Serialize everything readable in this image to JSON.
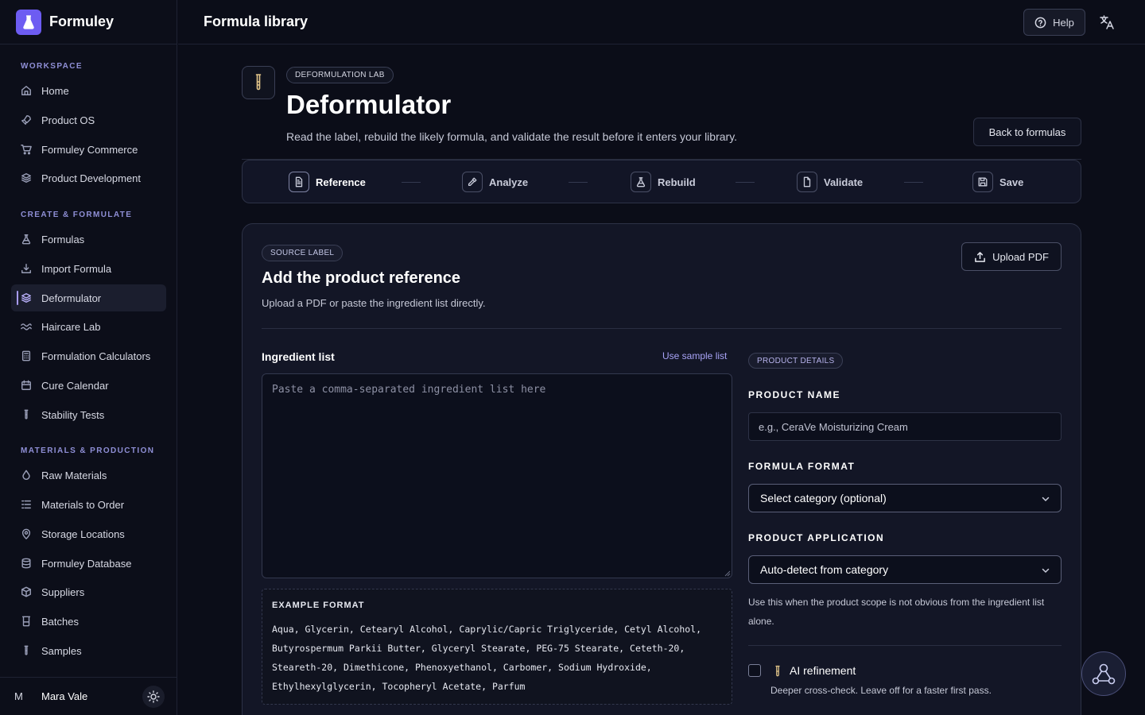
{
  "app": {
    "name": "Formuley",
    "page_heading": "Formula library",
    "help_label": "Help"
  },
  "sidebar": {
    "sections": [
      {
        "title": "WORKSPACE",
        "items": [
          {
            "label": "Home",
            "icon": "home-icon"
          },
          {
            "label": "Product OS",
            "icon": "rocket-icon"
          },
          {
            "label": "Formuley Commerce",
            "icon": "cart-icon"
          },
          {
            "label": "Product Development",
            "icon": "layers-icon"
          }
        ]
      },
      {
        "title": "CREATE & FORMULATE",
        "items": [
          {
            "label": "Formulas",
            "icon": "flask-icon"
          },
          {
            "label": "Import Formula",
            "icon": "download-icon"
          },
          {
            "label": "Deformulator",
            "icon": "layers-icon",
            "active": true
          },
          {
            "label": "Haircare Lab",
            "icon": "waves-icon"
          },
          {
            "label": "Formulation Calculators",
            "icon": "calculator-icon"
          },
          {
            "label": "Cure Calendar",
            "icon": "calendar-icon"
          },
          {
            "label": "Stability Tests",
            "icon": "test-tube-icon"
          }
        ]
      },
      {
        "title": "MATERIALS & PRODUCTION",
        "items": [
          {
            "label": "Raw Materials",
            "icon": "droplet-icon"
          },
          {
            "label": "Materials to Order",
            "icon": "list-icon"
          },
          {
            "label": "Storage Locations",
            "icon": "map-pin-icon"
          },
          {
            "label": "Formuley Database",
            "icon": "database-icon"
          },
          {
            "label": "Suppliers",
            "icon": "package-icon"
          },
          {
            "label": "Batches",
            "icon": "beaker-icon"
          },
          {
            "label": "Samples",
            "icon": "test-tube-icon"
          }
        ]
      }
    ],
    "user": {
      "initial": "M",
      "name": "Mara Vale"
    }
  },
  "header": {
    "badge": "DEFORMULATION LAB",
    "title": "Deformulator",
    "subtitle": "Read the label, rebuild the likely formula, and validate the result before it enters your library.",
    "back_label": "Back to formulas"
  },
  "steps": [
    {
      "label": "Reference",
      "icon": "document-icon",
      "active": true
    },
    {
      "label": "Analyze",
      "icon": "pipette-icon"
    },
    {
      "label": "Rebuild",
      "icon": "flask-icon"
    },
    {
      "label": "Validate",
      "icon": "file-check-icon"
    },
    {
      "label": "Save",
      "icon": "save-icon"
    }
  ],
  "card": {
    "badge": "SOURCE LABEL",
    "title": "Add the product reference",
    "subtitle": "Upload a PDF or paste the ingredient list directly.",
    "upload_label": "Upload PDF",
    "ingredients": {
      "label": "Ingredient list",
      "sample_link": "Use sample list",
      "placeholder": "Paste a comma-separated ingredient list here",
      "value": ""
    },
    "example": {
      "title": "EXAMPLE FORMAT",
      "lines": [
        "Aqua, Glycerin, Cetearyl Alcohol, Caprylic/Capric Triglyceride, Cetyl Alcohol,",
        "Butyrospermum Parkii Butter, Glyceryl Stearate, PEG-75 Stearate, Ceteth-20,",
        "Steareth-20, Dimethicone, Phenoxyethanol, Carbomer, Sodium Hydroxide,",
        "Ethylhexylglycerin, Tocopheryl Acetate, Parfum"
      ]
    },
    "details": {
      "badge": "PRODUCT DETAILS",
      "product_name_label": "PRODUCT NAME",
      "product_name_placeholder": "e.g., CeraVe Moisturizing Cream",
      "product_name_value": "",
      "format_label": "FORMULA FORMAT",
      "format_value": "Select category (optional)",
      "application_label": "PRODUCT APPLICATION",
      "application_value": "Auto-detect from category",
      "hint": "Use this when the product scope is not obvious from the ingredient list alone.",
      "ai_label": "AI refinement",
      "ai_sub": "Deeper cross-check. Leave off for a faster first pass.",
      "ai_checked": false
    }
  },
  "colors": {
    "accent": "#6d5cf2",
    "link": "#a8a3f6",
    "background": "#0b0d18",
    "card": "#131626"
  }
}
